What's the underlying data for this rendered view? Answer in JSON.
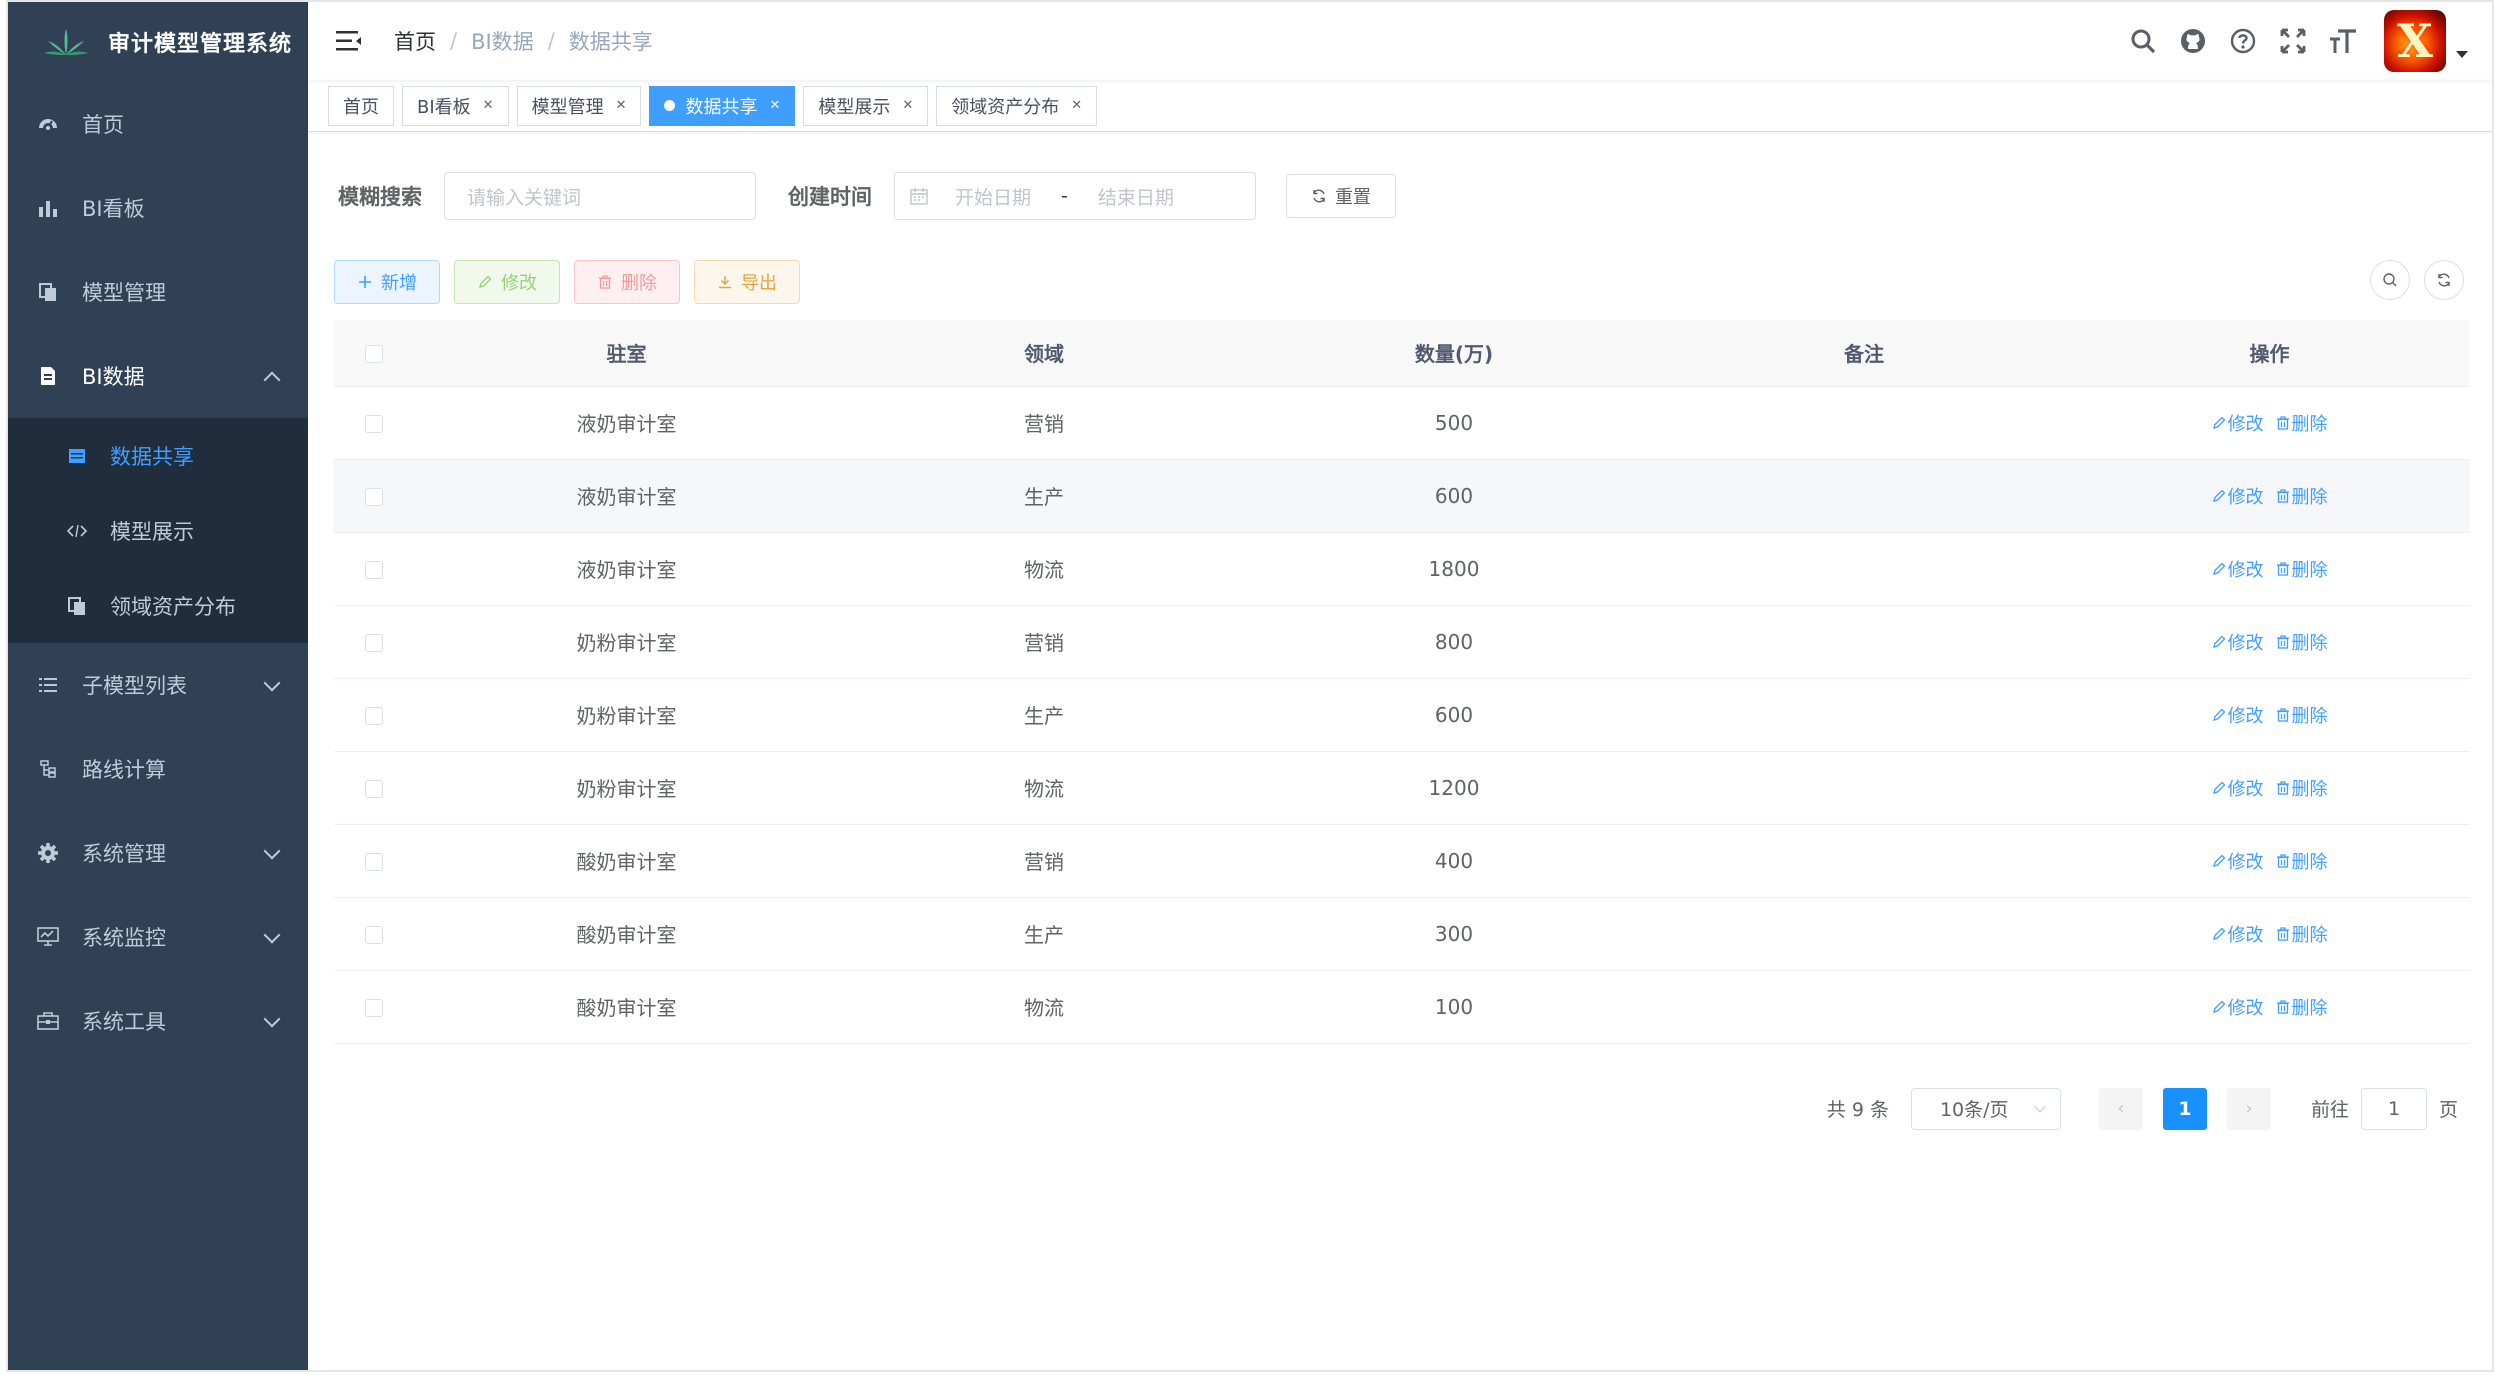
{
  "app": {
    "title": "审计模型管理系统"
  },
  "sidebar": {
    "items": [
      {
        "label": "首页",
        "icon": "dashboard-icon"
      },
      {
        "label": "BI看板",
        "icon": "bar-chart-icon"
      },
      {
        "label": "模型管理",
        "icon": "copy-icon"
      },
      {
        "label": "BI数据",
        "icon": "document-icon",
        "expanded": true,
        "children": [
          {
            "label": "数据共享",
            "icon": "table-icon",
            "active": true
          },
          {
            "label": "模型展示",
            "icon": "code-icon"
          },
          {
            "label": "领域资产分布",
            "icon": "copy-icon"
          }
        ]
      },
      {
        "label": "子模型列表",
        "icon": "list-icon"
      },
      {
        "label": "路线计算",
        "icon": "tree-icon"
      },
      {
        "label": "系统管理",
        "icon": "gear-icon"
      },
      {
        "label": "系统监控",
        "icon": "monitor-icon"
      },
      {
        "label": "系统工具",
        "icon": "toolbox-icon"
      }
    ]
  },
  "breadcrumb": [
    "首页",
    "BI数据",
    "数据共享"
  ],
  "tags": [
    {
      "label": "首页",
      "closable": false
    },
    {
      "label": "BI看板",
      "closable": true
    },
    {
      "label": "模型管理",
      "closable": true
    },
    {
      "label": "数据共享",
      "closable": true,
      "active": true
    },
    {
      "label": "模型展示",
      "closable": true
    },
    {
      "label": "领域资产分布",
      "closable": true
    }
  ],
  "search": {
    "fuzzy_label": "模糊搜索",
    "fuzzy_placeholder": "请输入关键词",
    "created_label": "创建时间",
    "start_placeholder": "开始日期",
    "range_sep": "-",
    "end_placeholder": "结束日期",
    "reset_label": "重置"
  },
  "toolbar": {
    "add": "新增",
    "edit": "修改",
    "delete": "删除",
    "export": "导出"
  },
  "table": {
    "columns": [
      "驻室",
      "领域",
      "数量(万)",
      "备注",
      "操作"
    ],
    "rows": [
      {
        "office": "液奶审计室",
        "domain": "营销",
        "qty": "500",
        "note": ""
      },
      {
        "office": "液奶审计室",
        "domain": "生产",
        "qty": "600",
        "note": ""
      },
      {
        "office": "液奶审计室",
        "domain": "物流",
        "qty": "1800",
        "note": ""
      },
      {
        "office": "奶粉审计室",
        "domain": "营销",
        "qty": "800",
        "note": ""
      },
      {
        "office": "奶粉审计室",
        "domain": "生产",
        "qty": "600",
        "note": ""
      },
      {
        "office": "奶粉审计室",
        "domain": "物流",
        "qty": "1200",
        "note": ""
      },
      {
        "office": "酸奶审计室",
        "domain": "营销",
        "qty": "400",
        "note": ""
      },
      {
        "office": "酸奶审计室",
        "domain": "生产",
        "qty": "300",
        "note": ""
      },
      {
        "office": "酸奶审计室",
        "domain": "物流",
        "qty": "100",
        "note": ""
      }
    ],
    "row_edit": "修改",
    "row_delete": "删除"
  },
  "pagination": {
    "total": "共 9 条",
    "page_size": "10条/页",
    "current": "1",
    "goto_label": "前往",
    "goto_value": "1",
    "page_suffix": "页"
  },
  "colors": {
    "sidebar_bg": "#304156",
    "submenu_bg": "#1f2d3d",
    "primary": "#409eff",
    "active_tag": "#409eff"
  }
}
